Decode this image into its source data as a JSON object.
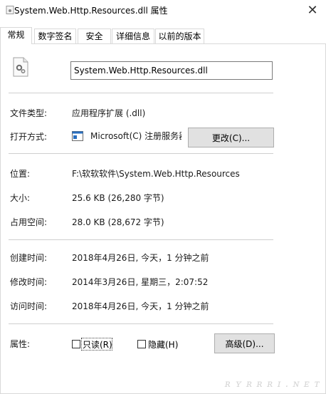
{
  "window": {
    "title": "System.Web.Http.Resources.dll 属性",
    "close_glyph": "✕"
  },
  "tabs": [
    {
      "label": "常规",
      "active": true
    },
    {
      "label": "数字签名",
      "active": false
    },
    {
      "label": "安全",
      "active": false
    },
    {
      "label": "详细信息",
      "active": false
    },
    {
      "label": "以前的版本",
      "active": false
    }
  ],
  "general": {
    "file_name": "System.Web.Http.Resources.dll",
    "file_type_label": "文件类型:",
    "file_type_value": "应用程序扩展 (.dll)",
    "open_with_label": "打开方式:",
    "open_with_value": "Microsoft(C) 注册服务器",
    "change_button": "更改(C)...",
    "location_label": "位置:",
    "location_value": "F:\\软软软件\\System.Web.Http.Resources",
    "size_label": "大小:",
    "size_value": "25.6 KB (26,280 字节)",
    "size_on_disk_label": "占用空间:",
    "size_on_disk_value": "28.0 KB (28,672 字节)",
    "created_label": "创建时间:",
    "created_value": "2018年4月26日, 今天，1 分钟之前",
    "modified_label": "修改时间:",
    "modified_value": "2014年3月26日, 星期三，2:07:52",
    "accessed_label": "访问时间:",
    "accessed_value": "2018年4月26日, 今天，1 分钟之前",
    "attributes_label": "属性:",
    "readonly_label": "只读(R)",
    "hidden_label": "隐藏(H)",
    "advanced_button": "高级(D)...",
    "readonly_checked": false,
    "hidden_checked": false
  },
  "icons": {
    "window_icon": "dll-file-icon",
    "file_icon": "dll-gear-file-icon",
    "open_with_icon": "application-window-icon"
  },
  "colors": {
    "button_face": "#e1e1e1",
    "separator": "#cfcfcf"
  }
}
